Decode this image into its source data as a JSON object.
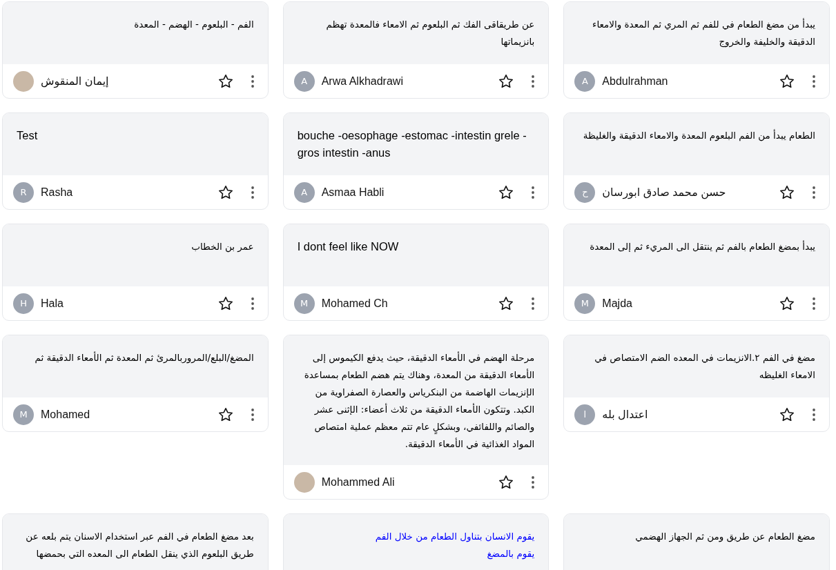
{
  "notes": [
    {
      "text": "يبدأ من مضغ الطعام في للفم ثم المري ثم المعدة والامعاء الدقيقة والخليفة والخروج",
      "kind": "arabic",
      "color": "#000000",
      "author": "Abdulrahman",
      "avatar": {
        "kind": "letter",
        "letter": "A"
      },
      "starred": false
    },
    {
      "text": "عن طريقاقى الفك ثم البلعوم ثم الامعاء فالمعدة تهظم بانزيماتها",
      "kind": "arabic",
      "color": "#000000",
      "author": "Arwa Alkhadrawi",
      "avatar": {
        "kind": "letter",
        "letter": "A"
      },
      "starred": false
    },
    {
      "text": "الفم - البلعوم - الهضم - المعدة",
      "kind": "arabic",
      "color": "#000000",
      "author": "إيمان المنقوش",
      "avatar": {
        "kind": "photo"
      },
      "starred": false
    },
    {
      "text": "الطعام يبدأ من الفم البلعوم المعدة والامعاء الدقيقة والغليظة",
      "kind": "arabic",
      "color": "#000000",
      "author": "حسن محمد صادق ابورسان",
      "avatar": {
        "kind": "letter",
        "letter": "ح"
      },
      "starred": false
    },
    {
      "text": "bouche -oesophage -estomac -intestin grele -gros intestin -anus",
      "kind": "latin",
      "color": "#000000",
      "author": "Asmaa Habli",
      "avatar": {
        "kind": "letter",
        "letter": "A"
      },
      "starred": false
    },
    {
      "text": "Test",
      "kind": "latin",
      "color": "#000000",
      "author": "Rasha",
      "avatar": {
        "kind": "letter",
        "letter": "R"
      },
      "starred": false
    },
    {
      "text": "يبدأ بمضغ الطعام بالفم ثم ينتقل الى المريء ثم إلى المعدة",
      "kind": "arabic",
      "color": "#000000",
      "author": "Majda",
      "avatar": {
        "kind": "letter",
        "letter": "M"
      },
      "starred": false
    },
    {
      "text": "I dont feel like NOW",
      "kind": "latin",
      "color": "#000000",
      "author": "Mohamed Ch",
      "avatar": {
        "kind": "letter",
        "letter": "M"
      },
      "starred": false
    },
    {
      "text": "عمر بن الخطاب",
      "kind": "arabic",
      "color": "#000000",
      "author": "Hala",
      "avatar": {
        "kind": "letter",
        "letter": "H"
      },
      "starred": false
    },
    {
      "text": "مضغ في الفم ٢.الانزيمات في المعده الضم الامتصاص في الامعاء الغليظه",
      "kind": "arabic",
      "color": "#000000",
      "author": "اعتدال بله",
      "avatar": {
        "kind": "letter",
        "letter": "ا"
      },
      "starred": false
    },
    {
      "text": "مرحلة الهضم في الأمعاء الدقيقة، حيث يدفع الكيموس إلى الأمعاء الدقيقة من المعدة، وهناك يتم هضم الطعام بمساعدة الإنزيمات الهاضمة من البنكرياس والعصارة الصفراوية من الكبد. وتتكون الأمعاء الدقيقة من ثلاث أعضاء: الإثنى عشر والصائم واللفائفي، وبشكلٍ عام تتم معظم عملية امتصاص المواد الغذائية في الأمعاء الدقيقة.",
      "kind": "arabic",
      "color": "#000000",
      "author": "Mohammed Ali",
      "avatar": {
        "kind": "photo"
      },
      "starred": false
    },
    {
      "text": "المضغ/البلع/المروربالمرئ ثم المعدة ثم الأمعاء الدقيقة ثم",
      "kind": "arabic",
      "color": "#000000",
      "author": "Mohamed",
      "avatar": {
        "kind": "letter",
        "letter": "M"
      },
      "starred": false
    },
    {
      "text": "مضغ الطعام عن طريق ومن ثم الجهاز الهضمي",
      "kind": "arabic",
      "color": "#000000"
    },
    {
      "text": "يقوم الانسان بتناول الطعام من خلال الفم\nيقوم بالمضغ",
      "kind": "arabic",
      "color": "#0000ff"
    },
    {
      "text": "بعد مضغ الطعام في الفم عبر استخدام الاسنان يتم بلعه عن طريق البلعوم الذي ينقل الطعام الى المعده التي بحمضها",
      "kind": "arabic",
      "color": "#000000"
    }
  ]
}
